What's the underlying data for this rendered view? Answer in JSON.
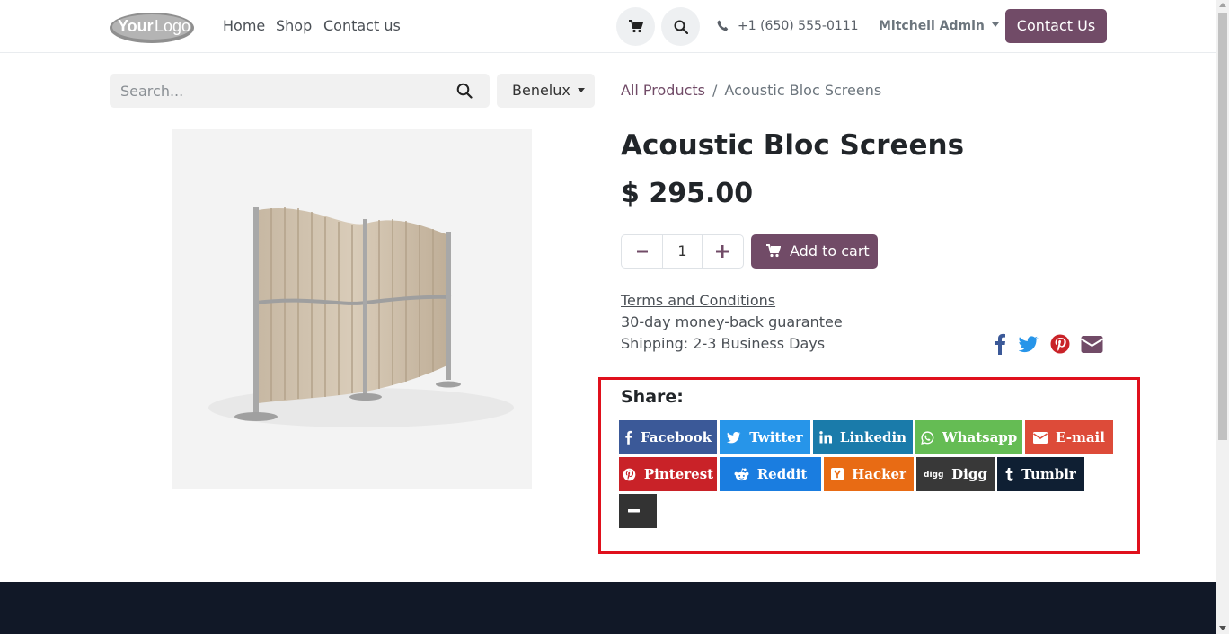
{
  "header": {
    "logo_text": "YourLogo",
    "nav": [
      "Home",
      "Shop",
      "Contact us"
    ],
    "phone": "+1 (650) 555-0111",
    "user": "Mitchell Admin",
    "contact_button": "Contact Us"
  },
  "search": {
    "placeholder": "Search...",
    "pricelist": "Benelux"
  },
  "breadcrumb": {
    "root": "All Products",
    "separator": "/",
    "current": "Acoustic Bloc Screens"
  },
  "product": {
    "title": "Acoustic Bloc Screens",
    "price": "$ 295.00",
    "quantity": "1",
    "add_to_cart": "Add to cart",
    "terms": "Terms and Conditions",
    "guarantee": "30-day money-back guarantee",
    "shipping": "Shipping: 2-3 Business Days"
  },
  "share": {
    "label": "Share:",
    "buttons": [
      {
        "label": "Facebook",
        "icon": "facebook-icon",
        "color": "#3b5998"
      },
      {
        "label": "Twitter",
        "icon": "twitter-icon",
        "color": "#2795e9"
      },
      {
        "label": "Linkedin",
        "icon": "linkedin-icon",
        "color": "#1a7baa"
      },
      {
        "label": "Whatsapp",
        "icon": "whatsapp-icon",
        "color": "#65bc54"
      },
      {
        "label": "E-mail",
        "icon": "email-icon",
        "color": "#dd4b39"
      },
      {
        "label": "Pinterest",
        "icon": "pinterest-icon",
        "color": "#c92228"
      },
      {
        "label": "Reddit",
        "icon": "reddit-icon",
        "color": "#1a7de0"
      },
      {
        "label": "Hacker",
        "icon": "hacker-news-icon",
        "color": "#e86b14"
      },
      {
        "label": "Digg",
        "icon": "digg-icon",
        "color": "#383838"
      },
      {
        "label": "Tumblr",
        "icon": "tumblr-icon",
        "color": "#0f1f33"
      },
      {
        "label": "",
        "icon": "minus-icon",
        "color": "#333333"
      }
    ]
  },
  "colors": {
    "brand": "#714B67",
    "highlight": "#e0101c",
    "footer": "#111827"
  }
}
